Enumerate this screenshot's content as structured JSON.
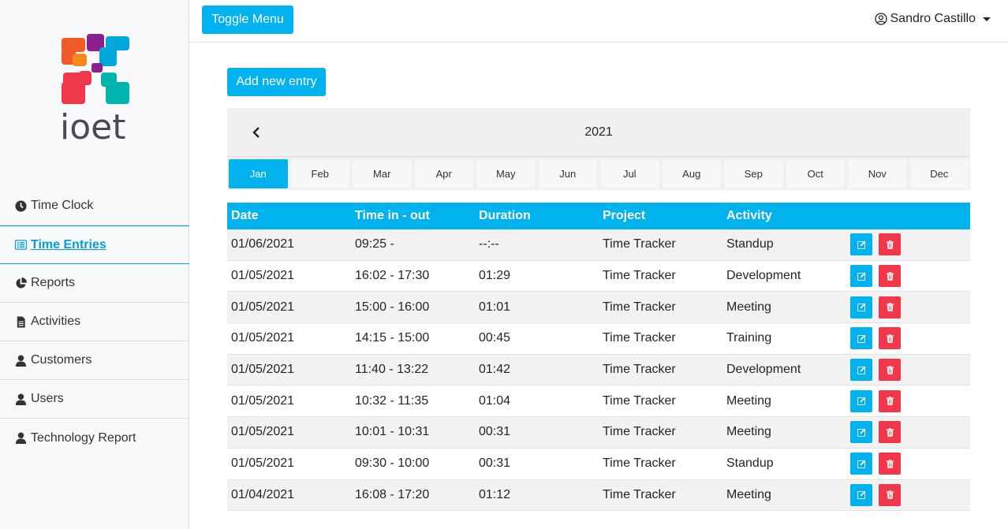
{
  "logo": {
    "text": "ioet"
  },
  "sidebar": {
    "items": [
      {
        "label": "Time Clock",
        "icon": "clock-icon",
        "active": false
      },
      {
        "label": "Time Entries",
        "icon": "list-icon",
        "active": true
      },
      {
        "label": "Reports",
        "icon": "pie-chart-icon",
        "active": false
      },
      {
        "label": "Activities",
        "icon": "file-icon",
        "active": false
      },
      {
        "label": "Customers",
        "icon": "user-icon",
        "active": false
      },
      {
        "label": "Users",
        "icon": "user-icon",
        "active": false
      },
      {
        "label": "Technology Report",
        "icon": "user-icon",
        "active": false
      }
    ]
  },
  "topbar": {
    "toggle_label": "Toggle Menu",
    "user_name": "Sandro Castillo"
  },
  "add_entry_label": "Add new entry",
  "calendar": {
    "year": "2021",
    "months": [
      "Jan",
      "Feb",
      "Mar",
      "Apr",
      "May",
      "Jun",
      "Jul",
      "Aug",
      "Sep",
      "Oct",
      "Nov",
      "Dec"
    ],
    "selected": "Jan"
  },
  "table": {
    "headers": [
      "Date",
      "Time in - out",
      "Duration",
      "Project",
      "Activity"
    ],
    "rows": [
      [
        "01/06/2021",
        "09:25 -",
        "--:--",
        "Time Tracker",
        "Standup"
      ],
      [
        "01/05/2021",
        "16:02 - 17:30",
        "01:29",
        "Time Tracker",
        "Development"
      ],
      [
        "01/05/2021",
        "15:00 - 16:00",
        "01:01",
        "Time Tracker",
        "Meeting"
      ],
      [
        "01/05/2021",
        "14:15 - 15:00",
        "00:45",
        "Time Tracker",
        "Training"
      ],
      [
        "01/05/2021",
        "11:40 - 13:22",
        "01:42",
        "Time Tracker",
        "Development"
      ],
      [
        "01/05/2021",
        "10:32 - 11:35",
        "01:04",
        "Time Tracker",
        "Meeting"
      ],
      [
        "01/05/2021",
        "10:01 - 10:31",
        "00:31",
        "Time Tracker",
        "Meeting"
      ],
      [
        "01/05/2021",
        "09:30 - 10:00",
        "00:31",
        "Time Tracker",
        "Standup"
      ],
      [
        "01/04/2021",
        "16:08 - 17:20",
        "01:12",
        "Time Tracker",
        "Meeting"
      ]
    ]
  },
  "colors": {
    "accent": "#00b2ee",
    "danger": "#f0384a"
  }
}
